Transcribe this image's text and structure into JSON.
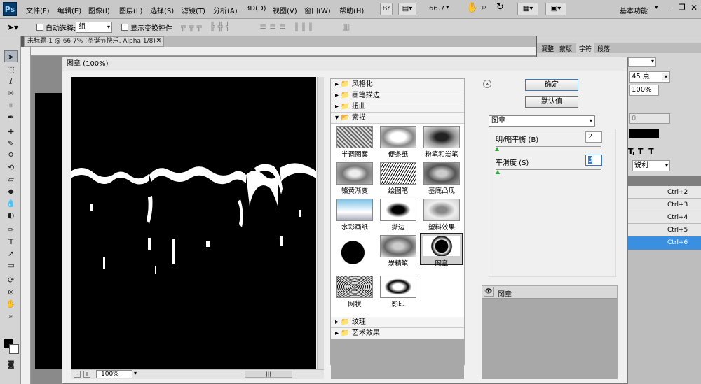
{
  "menubar": {
    "logo": "Ps",
    "items": [
      "文件(F)",
      "编辑(E)",
      "图像(I)",
      "图层(L)",
      "选择(S)",
      "滤镜(T)",
      "分析(A)",
      "3D(D)",
      "视图(V)",
      "窗口(W)",
      "帮助(H)"
    ],
    "zoom": "66.7",
    "workspace": "基本功能"
  },
  "optbar": {
    "auto_select": "自动选择:",
    "auto_select_value": "组",
    "show_transform": "显示变换控件"
  },
  "document": {
    "tab_title": "未标题-1 @ 66.7% (圣诞节快乐, Alpha 1/8) *"
  },
  "dialog": {
    "title": "图章 (100%)",
    "ok": "确定",
    "default": "默认值",
    "zoom": "100%",
    "filter_select": "图章",
    "params": [
      {
        "label": "明/暗平衡 (B)",
        "value": "2"
      },
      {
        "label": "平滑度 (S)",
        "value": "3"
      }
    ],
    "layer_name": "图章",
    "categories_top": [
      "风格化",
      "画笔描边",
      "扭曲",
      "素描"
    ],
    "categories_bottom": [
      "纹理",
      "艺术效果"
    ],
    "thumbnails": [
      "半调图案",
      "便条纸",
      "粉笔和炭笔",
      "铬黄渐变",
      "绘图笔",
      "基底凸现",
      "水彩画纸",
      "撕边",
      "塑料效果",
      "",
      "炭精笔",
      "图章",
      "网状",
      "影印"
    ]
  },
  "right_panel": {
    "tabs": [
      "调整",
      "蒙版",
      "字符",
      "段落"
    ],
    "font_size": "45 点",
    "scale": "100%",
    "tracking": "0",
    "antialias": "锐利",
    "shortcuts": [
      "Ctrl+2",
      "Ctrl+3",
      "Ctrl+4",
      "Ctrl+5",
      "Ctrl+6"
    ],
    "accent": "#3b8fe0"
  }
}
